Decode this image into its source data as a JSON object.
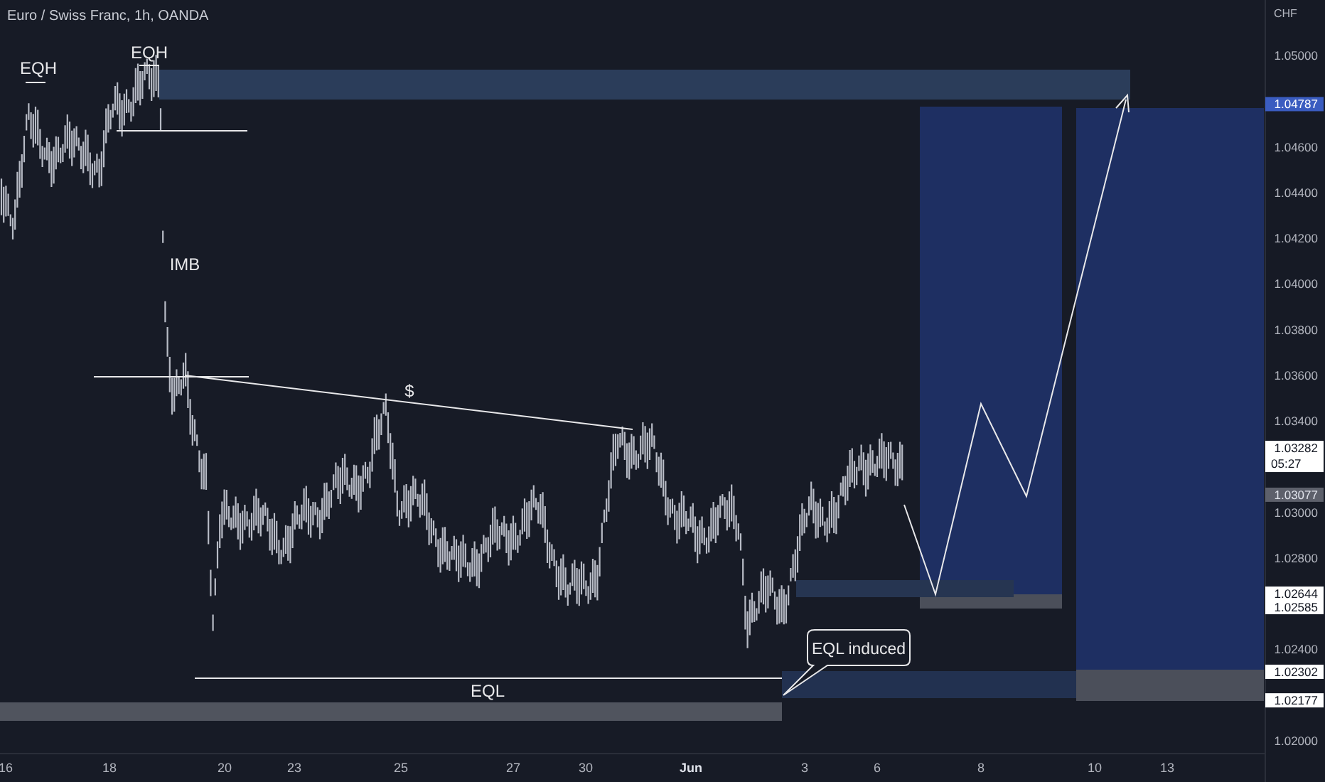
{
  "title": "Euro / Swiss Franc, 1h, OANDA",
  "price_axis": {
    "unit": "CHF",
    "labels": [
      "1.05000",
      "1.04600",
      "1.04400",
      "1.04200",
      "1.04000",
      "1.03800",
      "1.03600",
      "1.03400",
      "1.03000",
      "1.02800",
      "1.02400",
      "1.02000"
    ]
  },
  "price_badges": [
    {
      "kind": "highlight",
      "value": "1.04787"
    },
    {
      "kind": "label",
      "value": "1.03282",
      "countdown": "05:27"
    },
    {
      "kind": "muted",
      "value": "1.03077"
    },
    {
      "kind": "label",
      "value": "1.02644"
    },
    {
      "kind": "label",
      "value": "1.02585"
    },
    {
      "kind": "label",
      "value": "1.02302"
    },
    {
      "kind": "label",
      "value": "1.02177"
    }
  ],
  "time_axis": {
    "labels": [
      {
        "text": "16",
        "month": false
      },
      {
        "text": "18",
        "month": false
      },
      {
        "text": "20",
        "month": false
      },
      {
        "text": "23",
        "month": false
      },
      {
        "text": "25",
        "month": false
      },
      {
        "text": "27",
        "month": false
      },
      {
        "text": "30",
        "month": false
      },
      {
        "text": "Jun",
        "month": true
      },
      {
        "text": "3",
        "month": false
      },
      {
        "text": "6",
        "month": false
      },
      {
        "text": "8",
        "month": false
      },
      {
        "text": "10",
        "month": false
      },
      {
        "text": "13",
        "month": false
      }
    ]
  },
  "annotations": [
    {
      "kind": "text",
      "text": "EQH"
    },
    {
      "kind": "text",
      "text": "EQH"
    },
    {
      "kind": "text",
      "text": "IMB"
    },
    {
      "kind": "text",
      "text": "$"
    },
    {
      "kind": "text",
      "text": "EQL"
    },
    {
      "kind": "callout",
      "text": "EQL induced"
    }
  ]
}
